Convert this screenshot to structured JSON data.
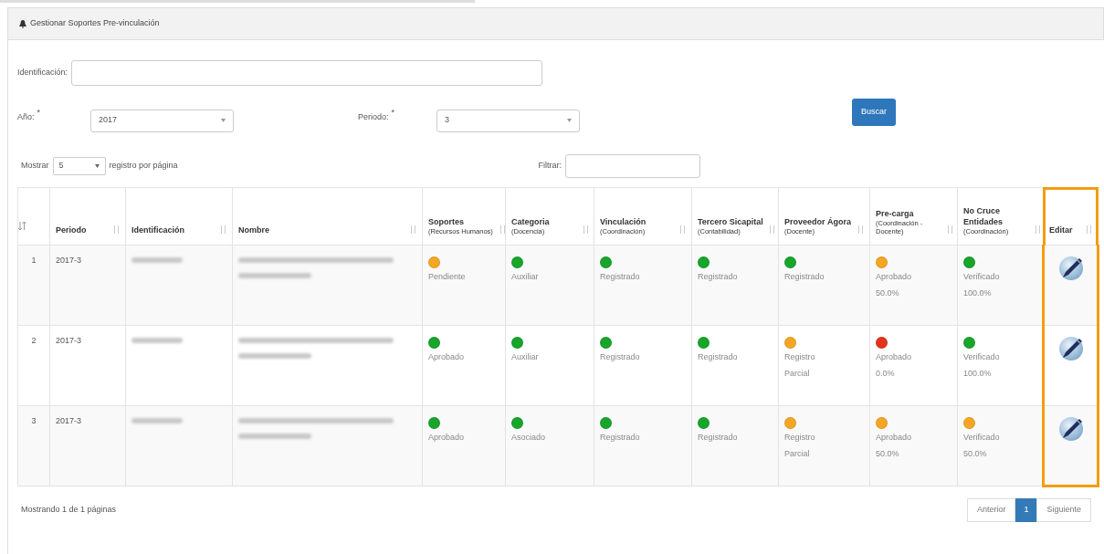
{
  "panel": {
    "title": "Gestionar Soportes Pre-vinculación"
  },
  "form": {
    "identificacion_label": "Identificación:",
    "anio": {
      "label": "Año:",
      "required_mark": "*",
      "value": "2017"
    },
    "periodo": {
      "label": "Periodo:",
      "required_mark": "*",
      "value": "3"
    },
    "search_button": "Buscar"
  },
  "table_controls": {
    "show_label": "Mostrar",
    "page_size": "5",
    "per_page_label": "registro por página",
    "filter_label": "Filtrar:"
  },
  "table": {
    "columns": [
      {
        "label": "Periodo"
      },
      {
        "label": "Identificación"
      },
      {
        "label": "Nombre"
      },
      {
        "label": "Soportes",
        "sublabel": "(Recursos Humanos)"
      },
      {
        "label": "Categoria",
        "sublabel": "(Docencia)"
      },
      {
        "label": "Vinculación",
        "sublabel": "(Coordinación)"
      },
      {
        "label": "Tercero Sicapital",
        "sublabel": "(Contabilidad)"
      },
      {
        "label": "Proveedor Ágora",
        "sublabel": "(Docente)"
      },
      {
        "label": "Pre-carga",
        "sublabel": "(Coordinación - Docente)"
      },
      {
        "label": "No Cruce Entidades",
        "sublabel": "(Coordinación)"
      },
      {
        "label": "Editar",
        "highlighted": true
      }
    ],
    "rows": [
      {
        "number": "1",
        "periodo": "2017-3",
        "statuses": [
          {
            "color": "#f5a623",
            "lines": [
              "Pendiente"
            ]
          },
          {
            "color": "#17a52a",
            "lines": [
              "Auxiliar"
            ]
          },
          {
            "color": "#17a52a",
            "lines": [
              "Registrado"
            ]
          },
          {
            "color": "#17a52a",
            "lines": [
              "Registrado"
            ]
          },
          {
            "color": "#17a52a",
            "lines": [
              "Registrado"
            ]
          },
          {
            "color": "#f5a623",
            "lines": [
              "Aprobado",
              "50.0%"
            ]
          },
          {
            "color": "#17a52a",
            "lines": [
              "Verificado",
              "100.0%"
            ]
          }
        ]
      },
      {
        "number": "2",
        "periodo": "2017-3",
        "statuses": [
          {
            "color": "#17a52a",
            "lines": [
              "Aprobado"
            ]
          },
          {
            "color": "#17a52a",
            "lines": [
              "Auxiliar"
            ]
          },
          {
            "color": "#17a52a",
            "lines": [
              "Registrado"
            ]
          },
          {
            "color": "#17a52a",
            "lines": [
              "Registrado"
            ]
          },
          {
            "color": "#f5a623",
            "lines": [
              "Registro",
              "Parcial"
            ]
          },
          {
            "color": "#e3331c",
            "lines": [
              "Aprobado",
              "0.0%"
            ]
          },
          {
            "color": "#17a52a",
            "lines": [
              "Verificado",
              "100.0%"
            ]
          }
        ]
      },
      {
        "number": "3",
        "periodo": "2017-3",
        "statuses": [
          {
            "color": "#17a52a",
            "lines": [
              "Aprobado"
            ]
          },
          {
            "color": "#17a52a",
            "lines": [
              "Asociado"
            ]
          },
          {
            "color": "#17a52a",
            "lines": [
              "Registrado"
            ]
          },
          {
            "color": "#17a52a",
            "lines": [
              "Registrado"
            ]
          },
          {
            "color": "#f5a623",
            "lines": [
              "Registro",
              "Parcial"
            ]
          },
          {
            "color": "#f5a623",
            "lines": [
              "Aprobado",
              "50.0%"
            ]
          },
          {
            "color": "#f5a623",
            "lines": [
              "Verificado",
              "50.0%"
            ]
          }
        ]
      }
    ]
  },
  "footer": {
    "info": "Mostrando 1 de 1 páginas",
    "pagination": [
      {
        "label": "Anterior",
        "selected": false
      },
      {
        "label": "1",
        "selected": true
      },
      {
        "label": "Siguiente",
        "selected": false
      }
    ]
  }
}
